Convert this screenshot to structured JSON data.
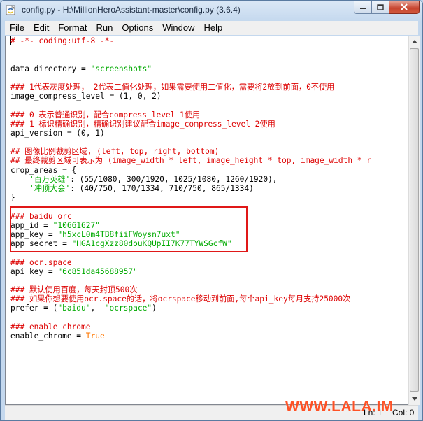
{
  "window": {
    "title": "config.py - H:\\MillionHeroAssistant-master\\config.py (3.6.4)"
  },
  "menu": [
    "File",
    "Edit",
    "Format",
    "Run",
    "Options",
    "Window",
    "Help"
  ],
  "code_lines": [
    [
      {
        "t": "cm",
        "v": "# -*- coding:utf-8 -*-"
      }
    ],
    [],
    [],
    [
      {
        "t": "tx",
        "v": "data_directory = "
      },
      {
        "t": "st",
        "v": "\"screenshots\""
      }
    ],
    [],
    [
      {
        "t": "cm",
        "v": "### 1代表灰度处理， 2代表二值化处理，如果需要使用二值化，需要将2放到前面，0不使用"
      }
    ],
    [
      {
        "t": "tx",
        "v": "image_compress_level = (1, 0, 2)"
      }
    ],
    [],
    [
      {
        "t": "cm",
        "v": "### 0 表示普通识别，配合compress_level 1使用"
      }
    ],
    [
      {
        "t": "cm",
        "v": "### 1 标识精确识别，精确识别建议配合image_compress_level 2使用"
      }
    ],
    [
      {
        "t": "tx",
        "v": "api_version = (0, 1)"
      }
    ],
    [],
    [
      {
        "t": "cm",
        "v": "## 图像比例裁剪区域, (left, top, right, bottom)"
      }
    ],
    [
      {
        "t": "cm",
        "v": "## 最终裁剪区域可表示为 (image_width * left, image_height * top, image_width * r"
      }
    ],
    [
      {
        "t": "tx",
        "v": "crop_areas = {"
      }
    ],
    [
      {
        "t": "tx",
        "v": "    "
      },
      {
        "t": "st",
        "v": "'百万英雄'"
      },
      {
        "t": "tx",
        "v": ": (55/1080, 300/1920, 1025/1080, 1260/1920),"
      }
    ],
    [
      {
        "t": "tx",
        "v": "    "
      },
      {
        "t": "st",
        "v": "'冲顶大会'"
      },
      {
        "t": "tx",
        "v": ": (40/750, 170/1334, 710/750, 865/1334)"
      }
    ],
    [
      {
        "t": "tx",
        "v": "}"
      }
    ],
    [],
    [
      {
        "t": "cm",
        "v": "### baidu orc"
      }
    ],
    [
      {
        "t": "tx",
        "v": "app_id = "
      },
      {
        "t": "st",
        "v": "\"10661627\""
      }
    ],
    [
      {
        "t": "tx",
        "v": "app_key = "
      },
      {
        "t": "st",
        "v": "\"h5xcL0m4TB8fiiFWoysn7uxt\""
      }
    ],
    [
      {
        "t": "tx",
        "v": "app_secret = "
      },
      {
        "t": "st",
        "v": "\"HGA1cgXzz80douKQUpII7K77TYWSGcfW\""
      }
    ],
    [],
    [
      {
        "t": "cm",
        "v": "### ocr.space"
      }
    ],
    [
      {
        "t": "tx",
        "v": "api_key = "
      },
      {
        "t": "st",
        "v": "\"6c851da45688957\""
      }
    ],
    [],
    [
      {
        "t": "cm",
        "v": "### 默认使用百度，每天封顶500次"
      }
    ],
    [
      {
        "t": "cm",
        "v": "### 如果你想要使用ocr.space的话，将ocrspace移动到前面,每个api_key每月支持25000次"
      }
    ],
    [
      {
        "t": "tx",
        "v": "prefer = ("
      },
      {
        "t": "st",
        "v": "\"baidu\""
      },
      {
        "t": "tx",
        "v": ",  "
      },
      {
        "t": "st",
        "v": "\"ocrspace\""
      },
      {
        "t": "tx",
        "v": ")"
      }
    ],
    [],
    [
      {
        "t": "cm",
        "v": "### enable chrome"
      }
    ],
    [
      {
        "t": "tx",
        "v": "enable_chrome = "
      },
      {
        "t": "kw",
        "v": "True"
      }
    ]
  ],
  "status": {
    "line": "Ln: 1",
    "col": "Col: 0"
  },
  "watermark": "WWW.LALA.IM"
}
